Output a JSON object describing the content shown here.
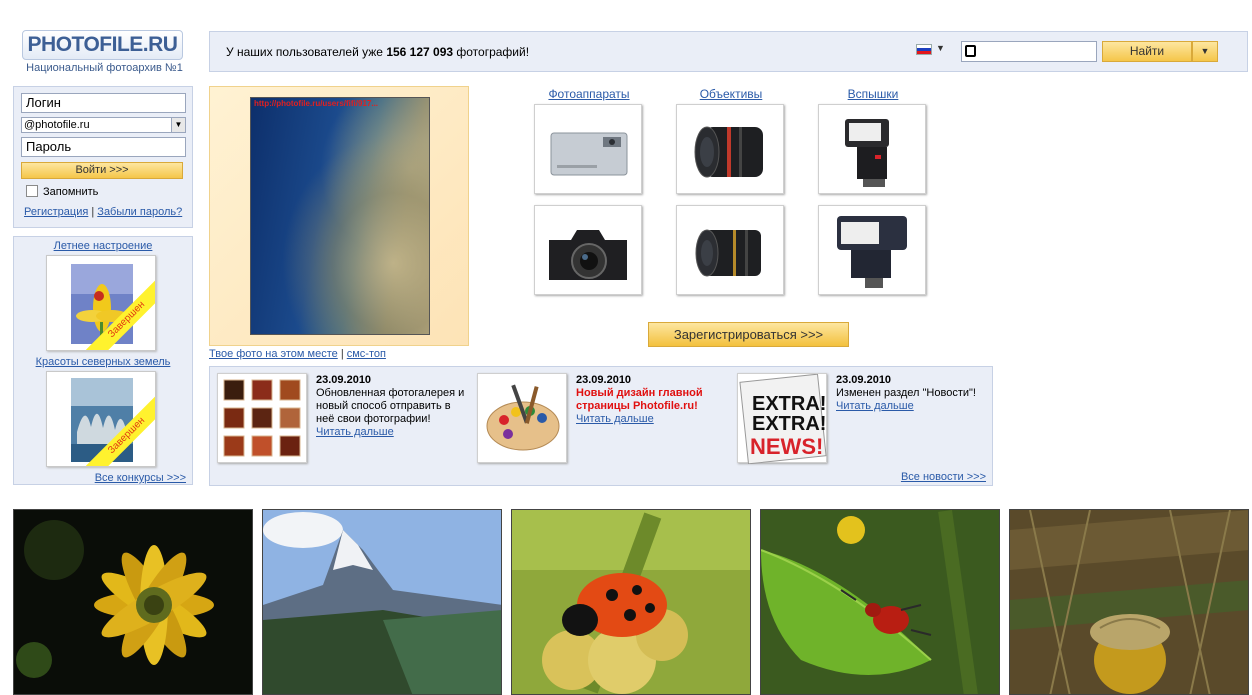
{
  "logo": {
    "text": "PHOTOFILE.RU",
    "tagline": "Национальный фотоархив №1"
  },
  "topbar": {
    "text_prefix": "У наших пользователей уже",
    "photo_count": "156 127 093",
    "text_suffix": "фотографий!",
    "language": "ru",
    "search_placeholder": "",
    "search_button": "Найти"
  },
  "login": {
    "login_placeholder": "Логин",
    "domain": "@photofile.ru",
    "password_placeholder": "Пароль",
    "submit": "Войти >>>",
    "remember": "Запомнить",
    "register": "Регистрация",
    "separator": "|",
    "forgot": "Забыли пароль?"
  },
  "contests": {
    "items": [
      {
        "title": "Летнее настроение",
        "status": "Завершен"
      },
      {
        "title": "Красоты северных земель",
        "status": "Завершен"
      }
    ],
    "all_label": "Все конкурсы >>>"
  },
  "featured": {
    "watermark": "http://photofile.ru/users/fifi/917...",
    "your_photo_link": "Твое фото на этом месте",
    "separator": "|",
    "sms_link": "смс-топ"
  },
  "categories": [
    {
      "label": "Фотоаппараты",
      "icons": [
        "compact-camera-icon",
        "dslr-camera-icon"
      ]
    },
    {
      "label": "Объективы",
      "icons": [
        "zoom-lens-icon",
        "telephoto-lens-icon"
      ]
    },
    {
      "label": "Вспышки",
      "icons": [
        "camera-flash-icon",
        "sony-flash-icon"
      ]
    }
  ],
  "register_button": "Зарегистрироваться >>>",
  "news": {
    "items": [
      {
        "date": "23.09.2010",
        "text": "Обновленная фотогалерея и новый способ отправить в неё свои фотографии!",
        "hot": false,
        "more": "Читать дальше",
        "thumb": "photo-gallery-icon"
      },
      {
        "date": "23.09.2010",
        "text": "Новый дизайн главной страницы Photofile.ru!",
        "hot": true,
        "more": "Читать дальше",
        "thumb": "paint-palette-icon"
      },
      {
        "date": "23.09.2010",
        "text": "Изменен раздел \"Новости\"!",
        "hot": false,
        "more": "Читать дальше",
        "thumb": "extra-news-icon"
      }
    ],
    "all_label": "Все новости >>>"
  },
  "bottom_photos": [
    {
      "subject": "yellow-flower"
    },
    {
      "subject": "mountain"
    },
    {
      "subject": "ladybug"
    },
    {
      "subject": "red-beetle-on-leaf"
    },
    {
      "subject": "acorn"
    }
  ]
}
